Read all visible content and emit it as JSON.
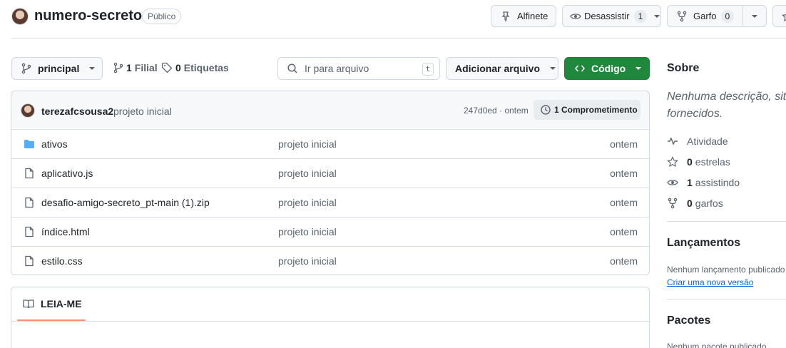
{
  "repo": {
    "name": "numero-secreto",
    "visibility": "Público"
  },
  "actions": {
    "pin_label": "Alfinete",
    "watch_label": "Desassistir",
    "watch_count": "1",
    "fork_label": "Garfo",
    "fork_count": "0"
  },
  "toolbar": {
    "branch": "principal",
    "branches_count": "1",
    "branches_label": "Filial",
    "tags_count": "0",
    "tags_label": "Etiquetas",
    "search_placeholder": "Ir para arquivo",
    "search_shortcut": "t",
    "add_file_label": "Adicionar arquivo",
    "code_label": "Código"
  },
  "commit": {
    "author": "terezafcsousa2",
    "message": "projeto inicial",
    "hash_time": "247d0ed · ontem",
    "commits_label": "1 Comprometimento"
  },
  "files": [
    {
      "name": "ativos",
      "type": "folder",
      "message": "projeto inicial",
      "time": "ontem"
    },
    {
      "name": "aplicativo.js",
      "type": "file",
      "message": "projeto inicial",
      "time": "ontem"
    },
    {
      "name": "desafio-amigo-secreto_pt-main (1).zip",
      "type": "file",
      "message": "projeto inicial",
      "time": "ontem"
    },
    {
      "name": "índice.html",
      "type": "file",
      "message": "projeto inicial",
      "time": "ontem"
    },
    {
      "name": "estilo.css",
      "type": "file",
      "message": "projeto inicial",
      "time": "ontem"
    }
  ],
  "readme": {
    "tab_label": "LEIA-ME"
  },
  "sidebar": {
    "about_title": "Sobre",
    "about_text_1": "Nenhuma descrição, site",
    "about_text_2": "fornecidos.",
    "activity_label": "Atividade",
    "stars_count": "0",
    "stars_label": "estrelas",
    "watching_count": "1",
    "watching_label": "assistindo",
    "forks_count": "0",
    "forks_label": "garfos",
    "releases_title": "Lançamentos",
    "releases_empty": "Nenhum lançamento publicado",
    "releases_link": "Criar uma nova versão",
    "packages_title": "Pacotes",
    "packages_empty": "Nenhum pacote publicado"
  },
  "colors": {
    "accent_green": "#1f883d",
    "link_blue": "#0969da",
    "folder_blue": "#54aeff",
    "readme_underline": "#fd8c73"
  }
}
